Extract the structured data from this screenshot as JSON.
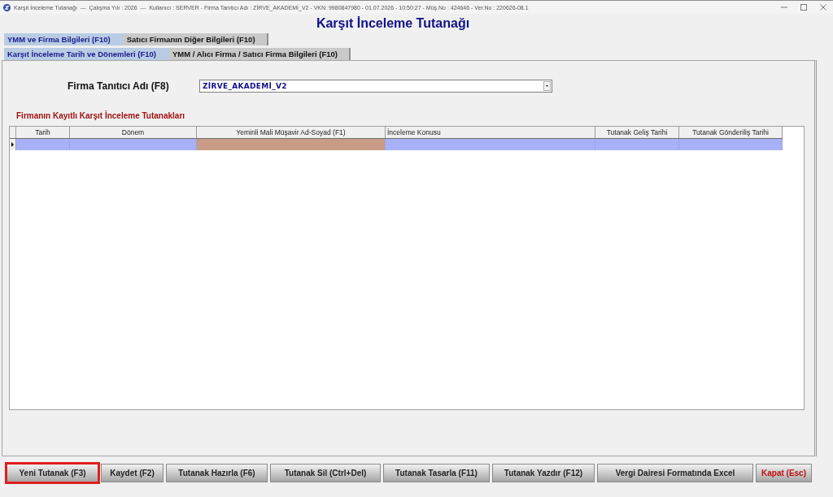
{
  "window": {
    "title": "Karşıt İnceleme Tutanağı  ---  Çalışma Yılı : 2026  ---  Kullanıcı : SERVER - Firma Tanıtıcı Adı : ZİRVE_AKADEMİ_V2 - VKN: 9980847980 - 01.07.2026 - 10:50:27 - Müş.No : 424646 - Ver.No : 220626-08.1"
  },
  "heading": "Karşıt İnceleme Tutanağı",
  "tab_rows": [
    {
      "tabs": [
        {
          "label": "YMM ve Firma Bilgileri (F10)",
          "selected": true
        },
        {
          "label": "Satıcı Firmanın Diğer Bilgileri (F10)",
          "selected": false
        }
      ]
    },
    {
      "tabs": [
        {
          "label": "Karşıt İnceleme Tarih ve Dönemleri (F10)",
          "selected": true
        },
        {
          "label": "YMM / Alıcı Firma / Satıcı Firma Bilgileri (F10)",
          "selected": false
        }
      ]
    }
  ],
  "firm_field": {
    "label": "Firma Tanıtıcı Adı (F8)",
    "value": "ZİRVE_AKADEMİ_V2"
  },
  "records": {
    "title": "Firmanın Kayıtlı Karşıt İnceleme Tutanakları",
    "columns": [
      "Tarih",
      "Dönem",
      "Yeminli Mali Müşavir Ad-Soyad (F1)",
      "İnceleme Konusu",
      "Tutanak Geliş Tarihi",
      "Tutanak Gönderiliş Tarihi"
    ],
    "rows": [
      {
        "selected": true,
        "current": true,
        "cells": [
          {
            "focused": false
          },
          {
            "focused": false
          },
          {
            "focused": true
          },
          {
            "focused": false
          },
          {
            "focused": false
          },
          {
            "focused": false
          }
        ]
      }
    ]
  },
  "buttons": [
    {
      "label": "Yeni Tutanak (F3)",
      "kind": "normal",
      "highlighted": true
    },
    {
      "label": "Kaydet (F2)",
      "kind": "normal",
      "highlighted": false
    },
    {
      "label": "Tutanak Hazırla (F6)",
      "kind": "normal",
      "highlighted": false
    },
    {
      "label": "Tutanak Sil (Ctrl+Del)",
      "kind": "normal",
      "highlighted": false
    },
    {
      "label": "Tutanak Tasarla (F11)",
      "kind": "normal",
      "highlighted": false
    },
    {
      "label": "Tutanak Yazdır (F12)",
      "kind": "normal",
      "highlighted": false
    },
    {
      "label": "Vergi Dairesi Formatında Excel",
      "kind": "normal",
      "highlighted": false
    },
    {
      "label": "Kapat (Esc)",
      "kind": "close",
      "highlighted": false
    }
  ]
}
